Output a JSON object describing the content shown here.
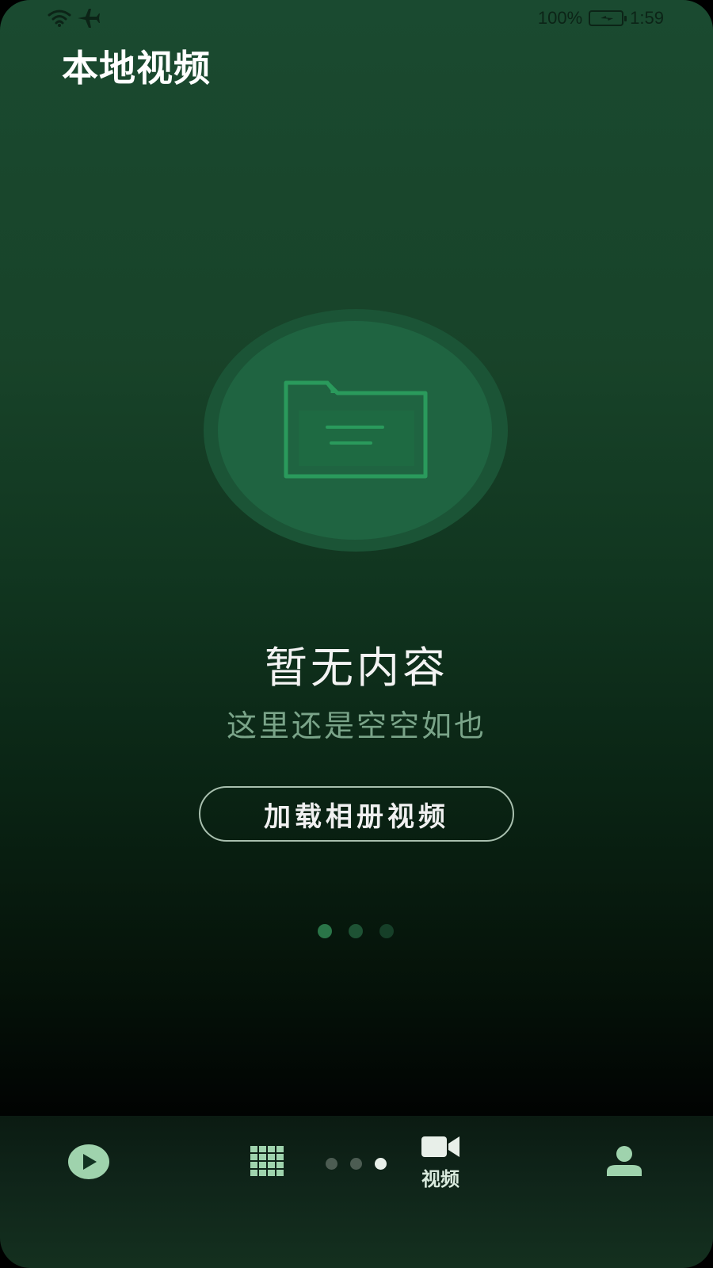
{
  "status_bar": {
    "battery_percent": "100%",
    "time": "1:59",
    "icons": [
      "wifi-icon",
      "airplane-icon",
      "battery-icon"
    ]
  },
  "header": {
    "title": "本地视频"
  },
  "empty_state": {
    "icon": "folder-icon",
    "title": "暂无内容",
    "subtitle": "这里还是空空如也",
    "button_label": "加载相册视频"
  },
  "page_indicator": {
    "count": 3,
    "active_index": 0
  },
  "bottom_nav": {
    "items": [
      {
        "icon": "play-icon",
        "label": ""
      },
      {
        "icon": "grid-icon",
        "label": ""
      },
      {
        "icon": "video-camera-icon",
        "label": "视频",
        "active": true
      },
      {
        "icon": "person-icon",
        "label": ""
      }
    ],
    "indicator": {
      "count": 3,
      "active_index": 2
    }
  },
  "colors": {
    "accent": "#9fd3ad",
    "background_top": "#1a4a30",
    "background_bottom": "#010302",
    "subtitle": "#7aa489"
  }
}
